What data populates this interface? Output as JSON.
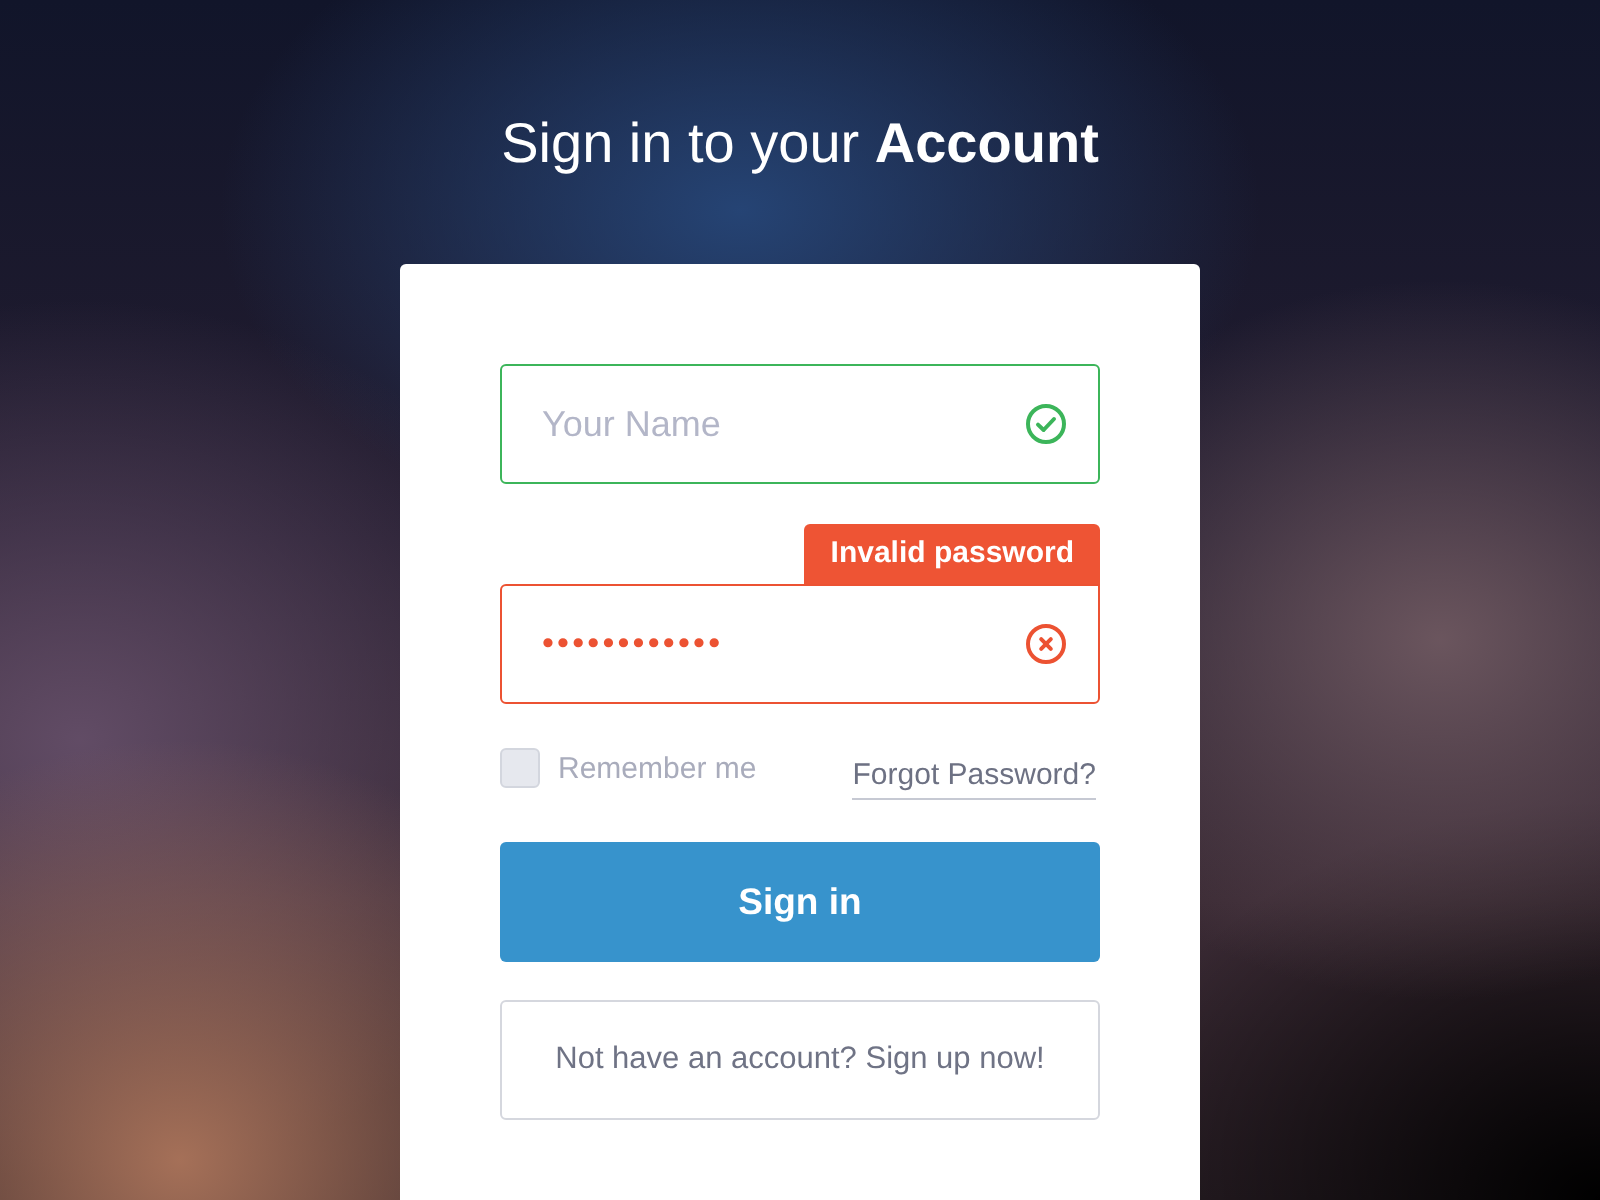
{
  "heading": "Sign in to your **Account**",
  "fields": [
    {
      "kind": "text",
      "placeholder": "Your Name",
      "valid": true
    },
    {
      "kind": "password",
      "value": "••••••••••••",
      "valid": false,
      "error": "Invalid password"
    }
  ],
  "remember": {
    "label": "Remember me",
    "checked": false
  },
  "forgot_link": "Forgot Password?",
  "sign_in_button": "Sign in",
  "signup_button": "Not have an account? Sign up now!"
}
